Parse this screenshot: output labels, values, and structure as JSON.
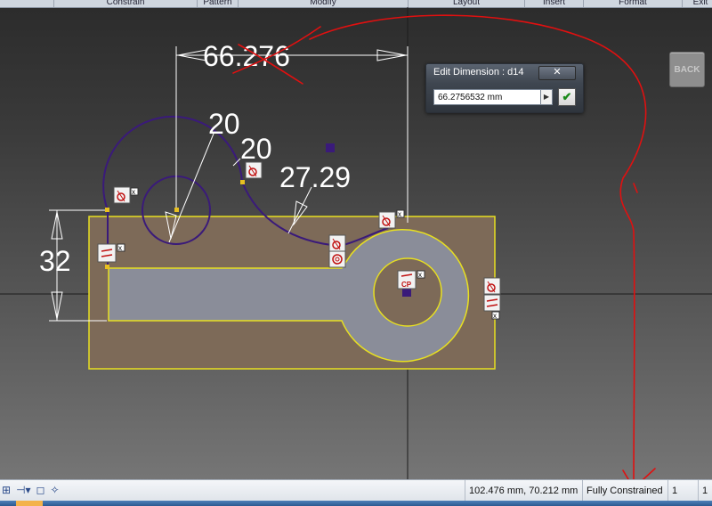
{
  "ribbon": {
    "tabs": [
      "Constrain",
      "Pattern",
      "Modify",
      "Layout",
      "Insert",
      "Format",
      "Exit"
    ]
  },
  "back_button": {
    "label": "BACK"
  },
  "dimensions": {
    "horizontal": "66.276",
    "radius_small": "20",
    "radius_arc": "20",
    "radius_large": "27.29",
    "vertical": "32"
  },
  "edit_dimension_dialog": {
    "title": "Edit Dimension : d14",
    "close_label": "✕",
    "value": "66.2756532 mm",
    "arrow_icon": "triangle-right-icon",
    "ok_icon": "checkmark-icon"
  },
  "constraint_glyph": {
    "coincident": "CP"
  },
  "status_bar": {
    "coordinates": "102.476 mm, 70.212 mm",
    "constraint_state": "Fully Constrained",
    "count_a": "1",
    "count_b": "1"
  },
  "colors": {
    "sketch_fill": "#7d6a58",
    "profile_outline": "#e8e020",
    "region_fill": "#8a8d99",
    "arc_curve": "#3a1a7a",
    "annotation_red": "#e01010"
  }
}
